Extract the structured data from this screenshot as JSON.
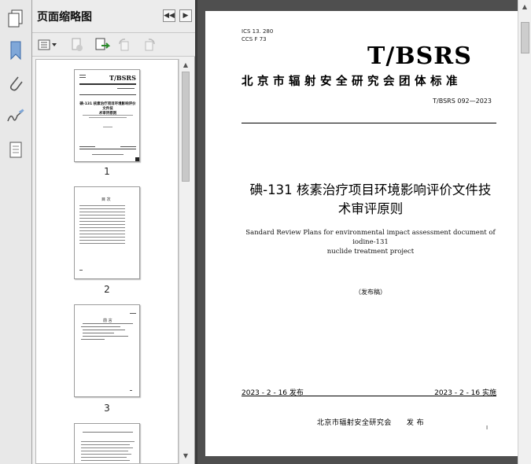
{
  "panel": {
    "title": "页面缩略图",
    "thumbnails": [
      {
        "number": "1"
      },
      {
        "number": "2"
      },
      {
        "number": "3"
      }
    ]
  },
  "thumb1": {
    "logo": "T/BSRS",
    "title_line1": "碘-131 核素治疗项目环境影响评价文件技",
    "title_line2": "术审评原则"
  },
  "thumb2": {
    "heading": "目 次"
  },
  "thumb3": {
    "heading": "前 言"
  },
  "document": {
    "ics": "ICS  13. 280",
    "ccs": "CCS  F  73",
    "logo": "T/BSRS",
    "organization": "北京市辐射安全研究会团体标准",
    "code": "T/BSRS 092—2023",
    "title_line1": "碘-131 核素治疗项目环境影响评价文件技",
    "title_line2": "术审评原则",
    "english_line1": "Sandard Review Plans for environmental impact assessment document of iodine-131",
    "english_line2": "nuclide treatment project",
    "status": "（发布稿）",
    "publish_date": "2023 - 2 - 16 发布",
    "implement_date": "2023 - 2 - 16 实施",
    "issuer": "北京市辐射安全研究会　　发 布",
    "page_number": "I"
  }
}
